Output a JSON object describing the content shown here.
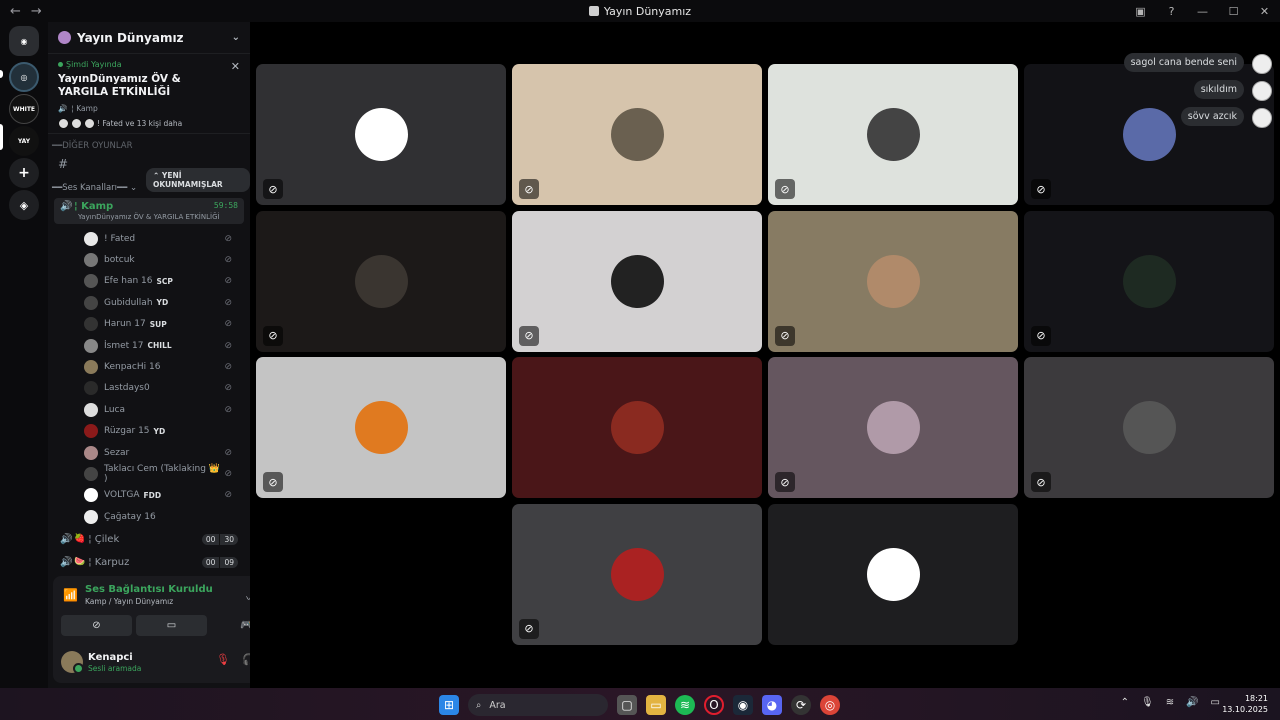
{
  "titlebar": {
    "title": "Yayın Dünyamız",
    "back": "←",
    "forward": "→"
  },
  "sidebar": {
    "guild_name": "Yayın Dünyamız",
    "live": {
      "label": "Şimdi Yayında",
      "title": "YayınDünyamız ÖV & YARGILA ETKİNLİĞİ",
      "channel": "¦ Kamp",
      "people": "! Fated ve 13 kişi daha"
    },
    "unread_pill": "YENİ OKUNMAMIŞLAR",
    "category_other": "DİĞER OYUNLAR",
    "category_voice": "Ses Kanalları",
    "active_channel": {
      "name": "¦ Kamp",
      "timer": "59:58",
      "status": "YayınDünyamız ÖV & YARGILA ETKİNLİĞİ"
    },
    "members": [
      {
        "name": "! Fated",
        "tag": "",
        "color": "#e8e8e8",
        "muted": true
      },
      {
        "name": "botcuk",
        "tag": "",
        "color": "#777",
        "muted": true
      },
      {
        "name": "Efe han 16",
        "tag": "SCP",
        "color": "#555",
        "muted": true
      },
      {
        "name": "Gubidullah",
        "tag": "YD",
        "color": "#444",
        "muted": true
      },
      {
        "name": "Harun 17",
        "tag": "SUP",
        "color": "#333",
        "muted": true
      },
      {
        "name": "İsmet 17",
        "tag": "CHILL",
        "color": "#888",
        "muted": true
      },
      {
        "name": "KenpacHi 16",
        "tag": "",
        "color": "#8a7a5a",
        "muted": true
      },
      {
        "name": "Lastdays0",
        "tag": "",
        "color": "#2a2a2a",
        "muted": true
      },
      {
        "name": "Luca",
        "tag": "",
        "color": "#ddd",
        "muted": true
      },
      {
        "name": "Rüzgar 15",
        "tag": "YD",
        "color": "#8b1a1a",
        "muted": false
      },
      {
        "name": "Sezar",
        "tag": "",
        "color": "#a88",
        "muted": true
      },
      {
        "name": "Taklacı Cem (Taklaking 👑 )",
        "tag": "",
        "color": "#444",
        "muted": true
      },
      {
        "name": "VOLTGA",
        "tag": "FDD",
        "color": "#fff",
        "muted": true
      },
      {
        "name": "Çağatay 16",
        "tag": "",
        "color": "#eee",
        "muted": false
      }
    ],
    "other_channels": [
      {
        "name": "¦ Çilek",
        "icon": "🍓",
        "counts": [
          "00",
          "30"
        ]
      },
      {
        "name": "¦ Karpuz",
        "icon": "🍉",
        "counts": [
          "00",
          "09"
        ]
      }
    ]
  },
  "voice_panel": {
    "status": "Ses Bağlantısı Kuruldu",
    "location": "Kamp / Yayın Dünyamız",
    "user_name": "Kenapci",
    "user_status": "Sesli aramada"
  },
  "chat_bubbles": [
    {
      "text": "sagol cana bende seni"
    },
    {
      "text": "sıkıldım"
    },
    {
      "text": "sövv azcık"
    }
  ],
  "tiles": [
    {
      "bg": "#303033",
      "face": "#ffffff",
      "muted": true
    },
    {
      "bg": "#d6c4ac",
      "face": "#6a6050",
      "muted": true
    },
    {
      "bg": "#dee2dd",
      "face": "#444",
      "muted": true
    },
    {
      "bg": "#121216",
      "face": "#5a6aa8",
      "muted": true
    },
    {
      "bg": "#1c1918",
      "face": "#3a3530",
      "muted": true
    },
    {
      "bg": "#d3d1d2",
      "face": "#222",
      "muted": true
    },
    {
      "bg": "#877b63",
      "face": "#b08a6a",
      "muted": true
    },
    {
      "bg": "#141418",
      "face": "#1e2a22",
      "muted": true
    },
    {
      "bg": "#c4c4c4",
      "face": "#e07a20",
      "muted": true
    },
    {
      "bg": "#4a1618",
      "face": "#8a2a20",
      "muted": false
    },
    {
      "bg": "#65565f",
      "face": "#b09aa8",
      "muted": true
    },
    {
      "bg": "#3c3a3d",
      "face": "#555",
      "muted": true
    },
    {
      "bg": "#404043",
      "face": "#aa2222",
      "muted": true
    },
    {
      "bg": "#1e1e20",
      "face": "#ffffff",
      "muted": false
    }
  ],
  "taskbar": {
    "search": "Ara",
    "time": "18:21",
    "date": "13.10.2025"
  }
}
